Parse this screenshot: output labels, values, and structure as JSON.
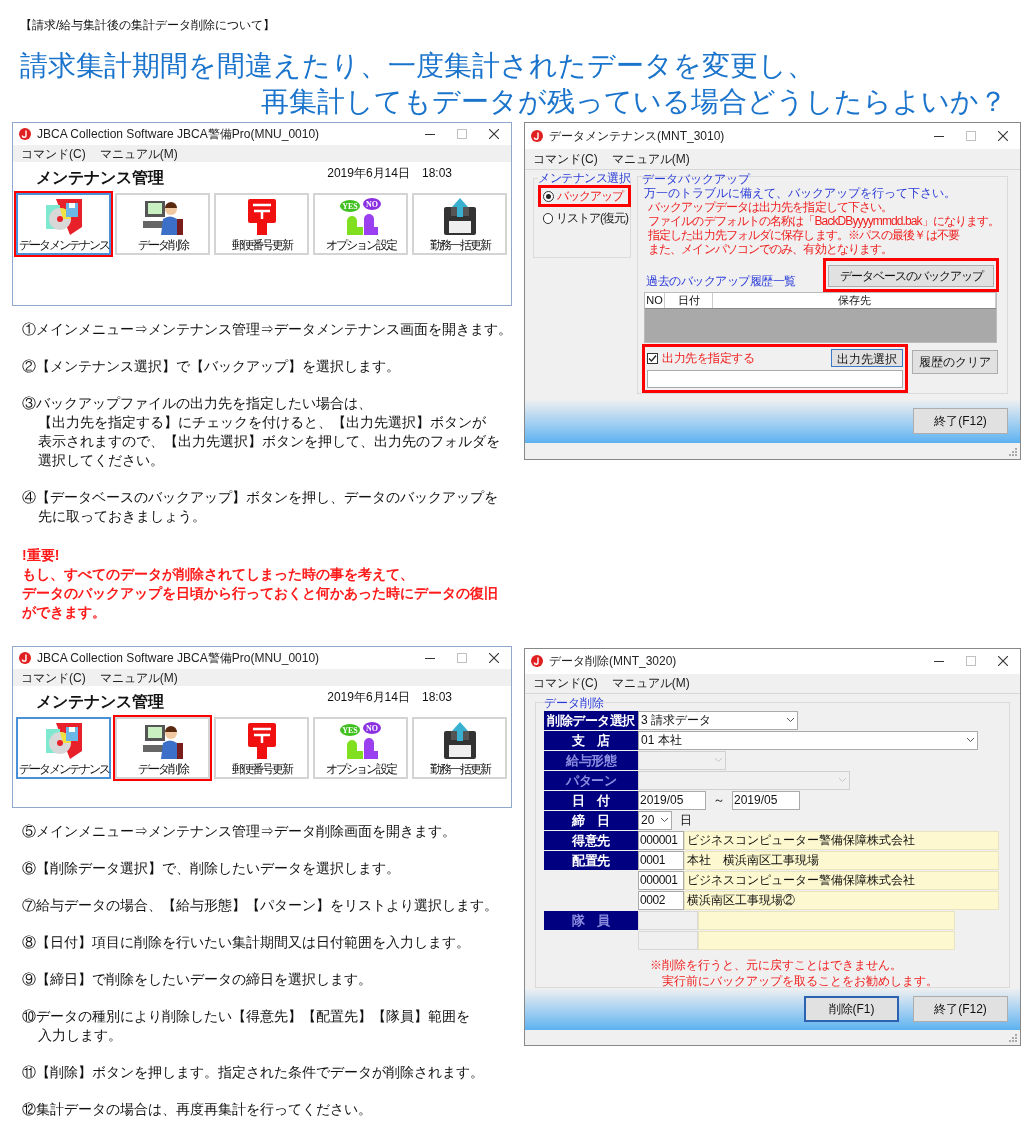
{
  "header_note": "【請求/給与集計後の集計データ削除について】",
  "title_lines": [
    "請求集計期間を間違えたり、一度集計されたデータを変更し、",
    "再集計してもデータが残っている場合どうしたらよいか？"
  ],
  "menu_windows": [
    {
      "title": "JBCA Collection Software JBCA警備Pro(MNU_0010)",
      "menu": [
        "コマンド(C)",
        "マニュアル(M)"
      ],
      "heading": "メンテナンス管理",
      "datetime": "2019年6月14日　18:03",
      "tiles": [
        {
          "label": "データメンテナンス",
          "kind": "disc",
          "focused": true,
          "highlighted": true
        },
        {
          "label": "データ削除",
          "kind": "person",
          "focused": false,
          "highlighted": false
        },
        {
          "label": "郵便番号更新",
          "kind": "postbox",
          "focused": false,
          "highlighted": false
        },
        {
          "label": "オプション設定",
          "kind": "yesno",
          "bubbles": [
            "YES",
            "NO"
          ],
          "focused": false,
          "highlighted": false
        },
        {
          "label": "勤務一括更新",
          "kind": "floppy",
          "focused": false,
          "highlighted": false
        }
      ]
    },
    {
      "title": "JBCA Collection Software JBCA警備Pro(MNU_0010)",
      "menu": [
        "コマンド(C)",
        "マニュアル(M)"
      ],
      "heading": "メンテナンス管理",
      "datetime": "2019年6月14日　18:03",
      "tiles": [
        {
          "label": "データメンテナンス",
          "kind": "disc",
          "focused": true,
          "highlighted": false
        },
        {
          "label": "データ削除",
          "kind": "person",
          "focused": false,
          "highlighted": true
        },
        {
          "label": "郵便番号更新",
          "kind": "postbox",
          "focused": false,
          "highlighted": false
        },
        {
          "label": "オプション設定",
          "kind": "yesno",
          "bubbles": [
            "YES",
            "NO"
          ],
          "focused": false,
          "highlighted": false
        },
        {
          "label": "勤務一括更新",
          "kind": "floppy",
          "focused": false,
          "highlighted": false
        }
      ]
    }
  ],
  "steps_1": [
    {
      "lines": [
        "①メインメニュー⇒メンテナンス管理⇒データメンテナンス画面を開きます。"
      ]
    },
    {
      "lines": [
        "②【メンテナンス選択】で【バックアップ】を選択します。"
      ]
    },
    {
      "lines": [
        "③バックアップファイルの出力先を指定したい場合は、",
        "【出力先を指定する】にチェックを付けると、【出力先選択】ボタンが",
        "表示されますので、【出力先選択】ボタンを押して、出力先のフォルダを",
        "選択してください。"
      ]
    },
    {
      "lines": [
        "④【データベースのバックアップ】ボタンを押し、データのバックアップを",
        "先に取っておきましょう。"
      ]
    }
  ],
  "important": {
    "title": "!重要!",
    "lines": [
      "もし、すべてのデータが削除されてしまった時の事を考えて、",
      "データのバックアップを日頃から行っておくと何かあった時にデータの復旧",
      "ができます。"
    ]
  },
  "backup_window": {
    "title": "データメンテナンス(MNT_3010)",
    "menu": [
      "コマンド(C)",
      "マニュアル(M)"
    ],
    "mode_group": {
      "legend": "メンテナンス選択",
      "options": [
        {
          "label": "バックアップ",
          "selected": true,
          "highlighted": true
        },
        {
          "label": "リストア(復元)",
          "selected": false,
          "highlighted": false
        }
      ]
    },
    "panel": {
      "legend": "データバックアップ",
      "intro": "万一のトラブルに備えて、バックアップを行って下さい。",
      "notes": [
        "バックアップデータは出力先を指定して下さい。",
        "ファイルのデフォルトの名称は「BackDByyyymmdd.bak」になります。",
        "指定した出力先フォルダに保存します。※パスの最後￥は不要",
        "また、メインパソコンでのみ、有効となります。"
      ],
      "backup_button": {
        "label": "データベースのバックアップ",
        "highlighted": true
      },
      "history_label": "過去のバックアップ履歴一覧",
      "history_columns": [
        "NO",
        "日付",
        "保存先"
      ],
      "output": {
        "label": "出力先を指定する",
        "checked": true,
        "button": "出力先選択",
        "highlighted": true
      },
      "clear_button": "履歴のクリア"
    },
    "footer_buttons": [
      {
        "label": "終了(F12)",
        "default": false
      }
    ]
  },
  "steps_2": [
    {
      "lines": [
        "⑤メインメニュー⇒メンテナンス管理⇒データ削除画面を開きます。"
      ]
    },
    {
      "lines": [
        "⑥【削除データ選択】で、削除したいデータを選択します。"
      ]
    },
    {
      "lines": [
        "⑦給与データの場合、【給与形態】【パターン】をリストより選択します。"
      ]
    },
    {
      "lines": [
        "⑧【日付】項目に削除を行いたい集計期間又は日付範囲を入力します。"
      ]
    },
    {
      "lines": [
        "⑨【締日】で削除をしたいデータの締日を選択します。"
      ]
    },
    {
      "lines": [
        "⑩データの種別により削除したい【得意先】【配置先】【隊員】範囲を",
        "入力します。"
      ]
    },
    {
      "lines": [
        "⑪【削除】ボタンを押します。指定された条件でデータが削除されます。"
      ]
    },
    {
      "lines": [
        "⑫集計データの場合は、再度再集計を行ってください。"
      ]
    }
  ],
  "delete_window": {
    "title": "データ削除(MNT_3020)",
    "menu": [
      "コマンド(C)",
      "マニュアル(M)"
    ],
    "legend": "データ削除",
    "rows": [
      {
        "kind": "select",
        "label": "削除データ選択",
        "value": "3 請求データ",
        "disabled": false
      },
      {
        "kind": "select",
        "label": "支　店",
        "value": "01 本社",
        "disabled": false
      },
      {
        "kind": "select",
        "label": "給与形態",
        "disabled": true
      },
      {
        "kind": "select",
        "label": "パターン",
        "disabled": true
      },
      {
        "kind": "date_range",
        "label": "日　付",
        "from": "2019/05",
        "separator": "～",
        "to": "2019/05",
        "disabled": false
      },
      {
        "kind": "day",
        "label": "締　日",
        "value": "20",
        "unit": "日",
        "disabled": false
      },
      {
        "kind": "code_name",
        "label": "得意先",
        "code": "000001",
        "name": "ビジネスコンピューター警備保障株式会社",
        "disabled": false
      },
      {
        "kind": "code_name",
        "label": "配置先",
        "code": "0001",
        "name": "本社　横浜南区工事現場",
        "disabled": false
      },
      {
        "kind": "code_name",
        "code": "000001",
        "name": "ビジネスコンピューター警備保障株式会社",
        "disabled": false
      },
      {
        "kind": "code_name",
        "code": "0002",
        "name": "横浜南区工事現場②",
        "disabled": false
      },
      {
        "kind": "code_name",
        "label": "隊　員",
        "disabled": true
      },
      {
        "kind": "code_name",
        "disabled": true
      }
    ],
    "warning_lines": [
      "※削除を行うと、元に戻すことはできません。",
      "実行前にバックアップを取ることをお勧めします。"
    ],
    "footer_buttons": [
      {
        "label": "削除(F1)",
        "default": true
      },
      {
        "label": "終了(F12)",
        "default": false
      }
    ]
  }
}
